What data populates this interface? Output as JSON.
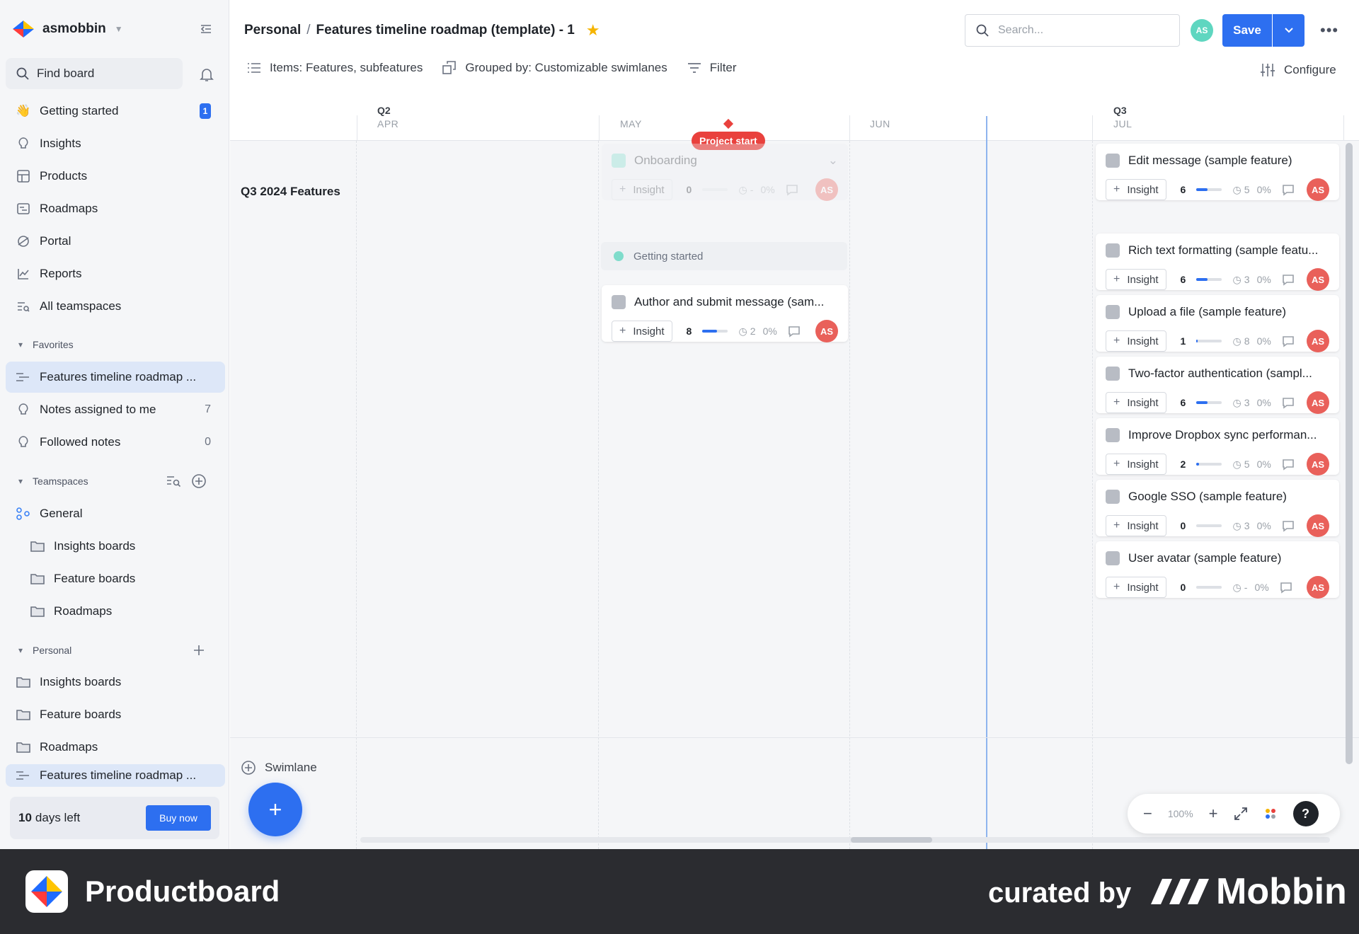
{
  "workspace": {
    "name": "asmobbin"
  },
  "sidebar": {
    "find_board": "Find board",
    "nav": [
      {
        "label": "Getting started",
        "badge": "1"
      },
      {
        "label": "Insights"
      },
      {
        "label": "Products"
      },
      {
        "label": "Roadmaps"
      },
      {
        "label": "Portal"
      },
      {
        "label": "Reports"
      },
      {
        "label": "All teamspaces"
      }
    ],
    "favorites_header": "Favorites",
    "favorites": [
      {
        "label": "Features timeline roadmap ..."
      },
      {
        "label": "Notes assigned to me",
        "count": "7"
      },
      {
        "label": "Followed notes",
        "count": "0"
      }
    ],
    "teamspaces_header": "Teamspaces",
    "general": "General",
    "general_children": [
      "Insights boards",
      "Feature boards",
      "Roadmaps"
    ],
    "personal_header": "Personal",
    "personal_children": [
      "Insights boards",
      "Feature boards",
      "Roadmaps",
      "Features timeline roadmap ..."
    ],
    "trial": {
      "days": "10",
      "suffix": "days left",
      "buy": "Buy now"
    }
  },
  "header": {
    "breadcrumb_parent": "Personal",
    "breadcrumb_sep": "/",
    "title": "Features timeline roadmap (template) - 1",
    "search_placeholder": "Search...",
    "avatar": "AS",
    "save": "Save"
  },
  "toolbar": {
    "items": "Items: Features, subfeatures",
    "grouped": "Grouped by: Customizable swimlanes",
    "filter": "Filter",
    "configure": "Configure"
  },
  "timeline": {
    "quarters": [
      "Q2",
      "Q3"
    ],
    "months": [
      "APR",
      "MAY",
      "JUN",
      "JUL"
    ],
    "milestone": "Project start",
    "swimlane_label": "Q3 2024 Features",
    "add_swimlane": "Swimlane",
    "zoom": "100%"
  },
  "cards": {
    "insight_label": "Insight",
    "avatar": "AS",
    "onboarding": {
      "title": "Onboarding",
      "score": "0",
      "effort": "-",
      "progress": "0%"
    },
    "getting_started": "Getting started",
    "author": {
      "title": "Author and submit message (sam...",
      "score": "8",
      "fill": 0.6,
      "effort": "2",
      "progress": "0%"
    },
    "right": [
      {
        "title": "Edit message (sample feature)",
        "score": "6",
        "fill": 0.45,
        "effort": "5",
        "progress": "0%"
      },
      {
        "title": "Rich text formatting (sample featu...",
        "score": "6",
        "fill": 0.45,
        "effort": "3",
        "progress": "0%"
      },
      {
        "title": "Upload a file (sample feature)",
        "score": "1",
        "fill": 0.08,
        "effort": "8",
        "progress": "0%"
      },
      {
        "title": "Two-factor authentication (sampl...",
        "score": "6",
        "fill": 0.45,
        "effort": "3",
        "progress": "0%"
      },
      {
        "title": "Improve Dropbox sync performan...",
        "score": "2",
        "fill": 0.12,
        "effort": "5",
        "progress": "0%"
      },
      {
        "title": "Google SSO (sample feature)",
        "score": "0",
        "fill": 0,
        "effort": "3",
        "progress": "0%"
      },
      {
        "title": "User avatar (sample feature)",
        "score": "0",
        "fill": 0,
        "effort": "-",
        "progress": "0%"
      }
    ]
  },
  "footer": {
    "brand": "Productboard",
    "curated": "curated by",
    "mobbin": "Mobbin"
  },
  "colors": {
    "accent": "#2d6ff0",
    "milestone": "#e9413d",
    "avatar": "#e9605a",
    "sidebar_bg": "#f5f6f8"
  }
}
